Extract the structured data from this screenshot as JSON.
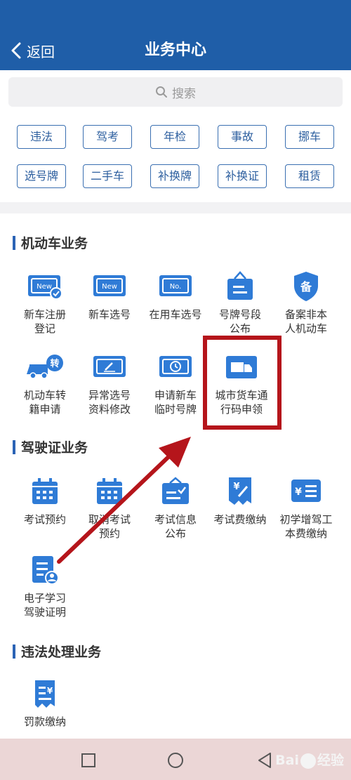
{
  "header": {
    "back_label": "返回",
    "title": "业务中心",
    "color": "#1f5ea8"
  },
  "search": {
    "placeholder": "搜索"
  },
  "chips": [
    "违法",
    "驾考",
    "年检",
    "事故",
    "挪车",
    "选号牌",
    "二手车",
    "补换牌",
    "补换证",
    "租赁"
  ],
  "sections": {
    "vehicle": {
      "title": "机动车业务",
      "items": [
        {
          "label": "新车注册\n登记",
          "icon": "new-plate-check-icon"
        },
        {
          "label": "新车选号",
          "icon": "new-plate-icon"
        },
        {
          "label": "在用车选号",
          "icon": "no-plate-icon"
        },
        {
          "label": "号牌号段\n公布",
          "icon": "plate-board-icon"
        },
        {
          "label": "备案非本\n人机动车",
          "icon": "shield-bei-icon"
        },
        {
          "label": "机动车转\n籍申请",
          "icon": "truck-transfer-icon"
        },
        {
          "label": "异常选号\n资料修改",
          "icon": "edit-plate-icon"
        },
        {
          "label": "申请新车\n临时号牌",
          "icon": "clock-plate-icon"
        },
        {
          "label": "城市货车通\n行码申领",
          "icon": "truck-icon"
        }
      ]
    },
    "license": {
      "title": "驾驶证业务",
      "items": [
        {
          "label": "考试预约",
          "icon": "calendar-icon"
        },
        {
          "label": "取消考试\n预约",
          "icon": "calendar-cancel-icon"
        },
        {
          "label": "考试信息\n公布",
          "icon": "exam-info-icon"
        },
        {
          "label": "考试费缴纳",
          "icon": "fee-pen-icon"
        },
        {
          "label": "初学增驾工\n本费缴纳",
          "icon": "fee-list-icon"
        },
        {
          "label": "电子学习\n驾驶证明",
          "icon": "doc-user-icon"
        }
      ]
    },
    "violation": {
      "title": "违法处理业务",
      "items": [
        {
          "label": "罚款缴纳",
          "icon": "fine-receipt-icon"
        }
      ]
    }
  },
  "watermark": {
    "text_left": "Bai",
    "text_right": "经验"
  },
  "colors": {
    "accent": "#2b63b5",
    "highlight": "#b5151b",
    "navbar": "#ebd6d6"
  }
}
